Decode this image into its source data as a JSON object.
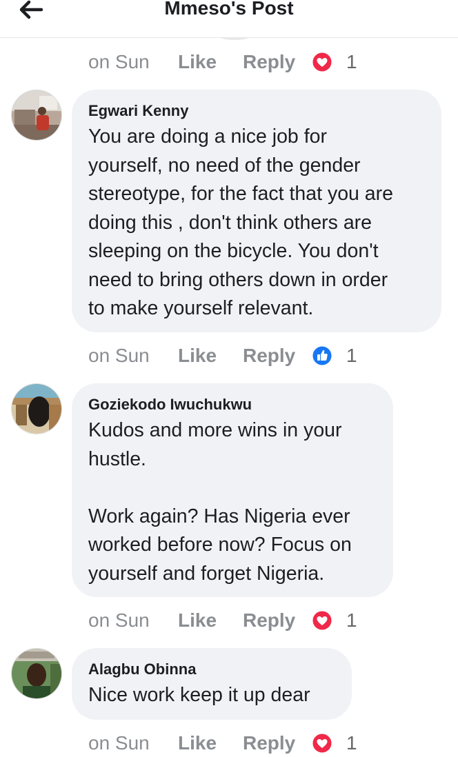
{
  "header": {
    "title": "Mmeso's Post"
  },
  "comments": [
    {
      "author": "Egwari Kenny",
      "text": "You are doing a nice job for\nyourself, no need of the gender\nstereotype, for the fact that you are\ndoing this , don't think others are\nsleeping on the bicycle.  You don't\nneed to bring others down in order\nto make yourself relevant.",
      "time": "on Sun",
      "like_label": "Like",
      "reply_label": "Reply",
      "reaction": "like",
      "reaction_count": "1"
    },
    {
      "author": "Goziekodo Iwuchukwu",
      "text": "Kudos and more wins in your\nhustle.\n\nWork again? Has Nigeria ever\nworked before now? Focus on\nyourself and forget Nigeria.",
      "time": "on Sun",
      "like_label": "Like",
      "reply_label": "Reply",
      "reaction": "love",
      "reaction_count": "1"
    },
    {
      "author": "Alagbu Obinna",
      "text": "Nice work keep it up dear",
      "time": "on Sun",
      "like_label": "Like",
      "reply_label": "Reply",
      "reaction": "love",
      "reaction_count": "1"
    }
  ],
  "top_actions": {
    "time": "on Sun",
    "like_label": "Like",
    "reply_label": "Reply",
    "reaction": "love",
    "reaction_count": "1"
  },
  "icons": {
    "back": "arrow-left-icon",
    "love": "love-reaction-icon",
    "like": "like-reaction-icon"
  },
  "colors": {
    "love": "#f02849",
    "like": "#1877f2",
    "bubble": "#f0f2f5",
    "meta_text": "#8a8d91"
  }
}
